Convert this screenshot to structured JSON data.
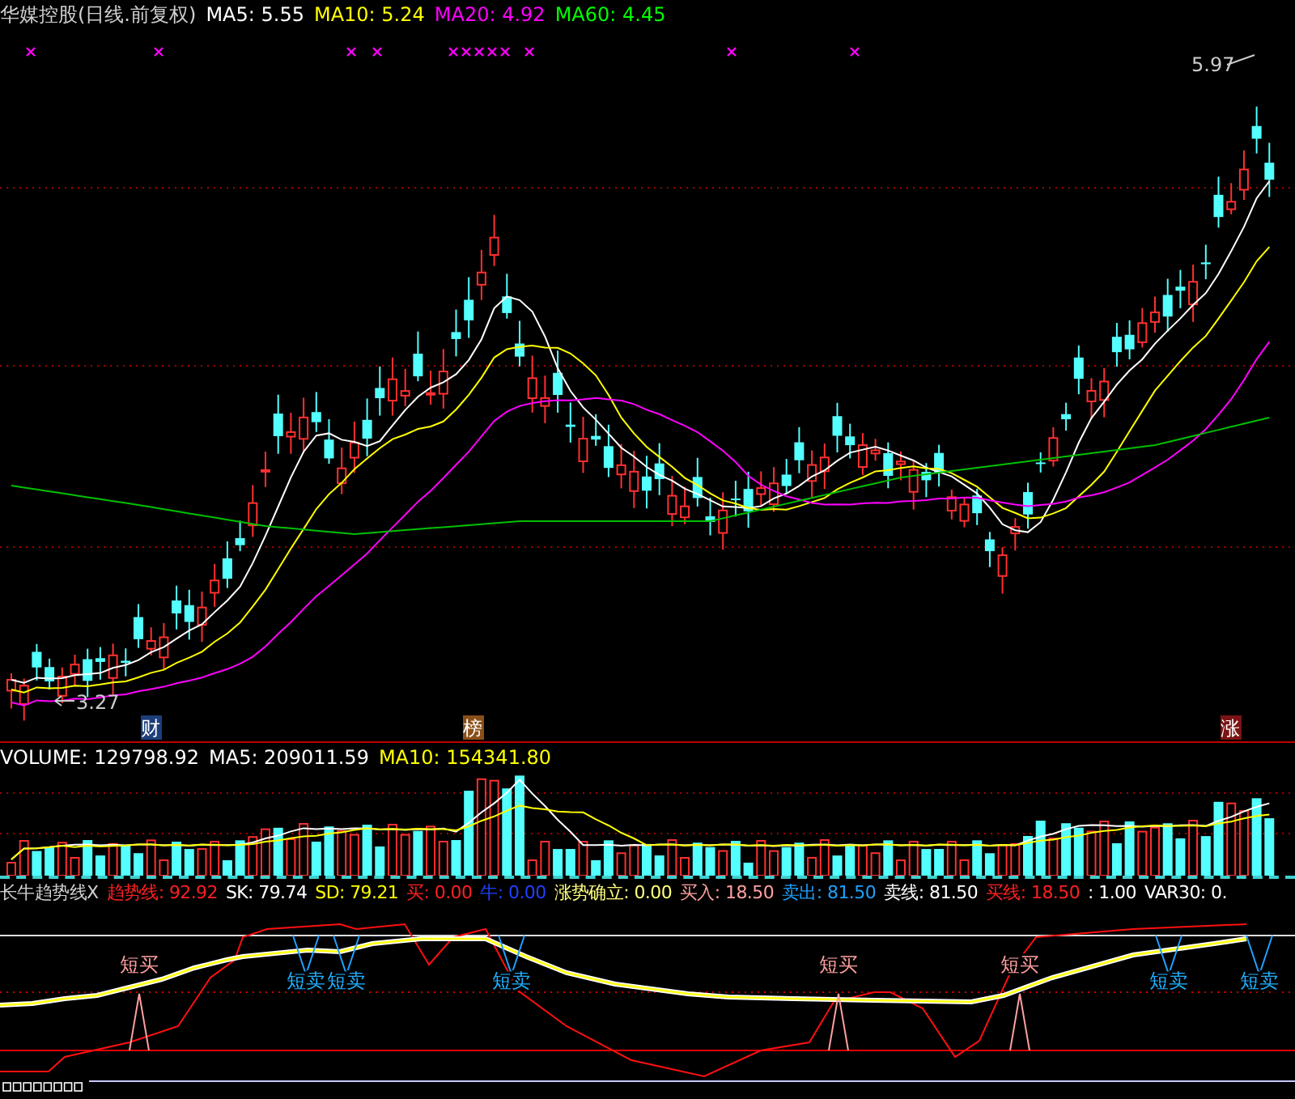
{
  "price_header": {
    "title": "华媒控股(日线.前复权)",
    "indicators": [
      {
        "text": "MA5: 5.55",
        "color": "#ffffff"
      },
      {
        "text": "MA10: 5.24",
        "color": "#ffff00"
      },
      {
        "text": "MA20: 4.92",
        "color": "#ff00ff"
      },
      {
        "text": "MA60: 4.45",
        "color": "#00ff00"
      }
    ]
  },
  "price_panel": {
    "high_label": "5.97",
    "low_label": "3.27",
    "badges": [
      {
        "text": "财",
        "color": "#1c3f7a"
      },
      {
        "text": "榜",
        "color": "#8a4f18"
      },
      {
        "text": "涨",
        "color": "#7a1414"
      }
    ]
  },
  "volume_header": {
    "indicators": [
      {
        "text": "VOLUME: 129798.92",
        "color": "#ffffff"
      },
      {
        "text": "MA5: 209011.59",
        "color": "#ffffff"
      },
      {
        "text": "MA10: 154341.80",
        "color": "#ffff00"
      }
    ]
  },
  "indicator_header": {
    "title": "长牛趋势线X",
    "indicators": [
      {
        "text": "趋势线: 92.92",
        "color": "#ff2020"
      },
      {
        "text": "SK: 79.74",
        "color": "#ffffff"
      },
      {
        "text": "SD: 79.21",
        "color": "#ffff00"
      },
      {
        "text": "买: 0.00",
        "color": "#ff2020"
      },
      {
        "text": "牛: 0.00",
        "color": "#2040ff"
      },
      {
        "text": "涨势确立: 0.00",
        "color": "#ffff80"
      },
      {
        "text": "买入: 18.50",
        "color": "#ffa0a0"
      },
      {
        "text": "卖出: 81.50",
        "color": "#20a0ff"
      },
      {
        "text": "卖线: 81.50",
        "color": "#ffffff"
      },
      {
        "text": "买线: 18.50",
        "color": "#ff2020"
      },
      {
        "text": ": 1.00",
        "color": "#ffffff"
      },
      {
        "text": "VAR30: 0.",
        "color": "#ffffff"
      }
    ]
  },
  "signals": [
    {
      "kind": "buy",
      "text": "短买"
    },
    {
      "kind": "sell",
      "text": "短卖"
    },
    {
      "kind": "sell",
      "text": "短卖"
    },
    {
      "kind": "sell",
      "text": "短卖"
    },
    {
      "kind": "buy",
      "text": "短买"
    },
    {
      "kind": "buy",
      "text": "短买"
    },
    {
      "kind": "sell",
      "text": "短卖"
    },
    {
      "kind": "sell",
      "text": "短卖"
    }
  ]
}
